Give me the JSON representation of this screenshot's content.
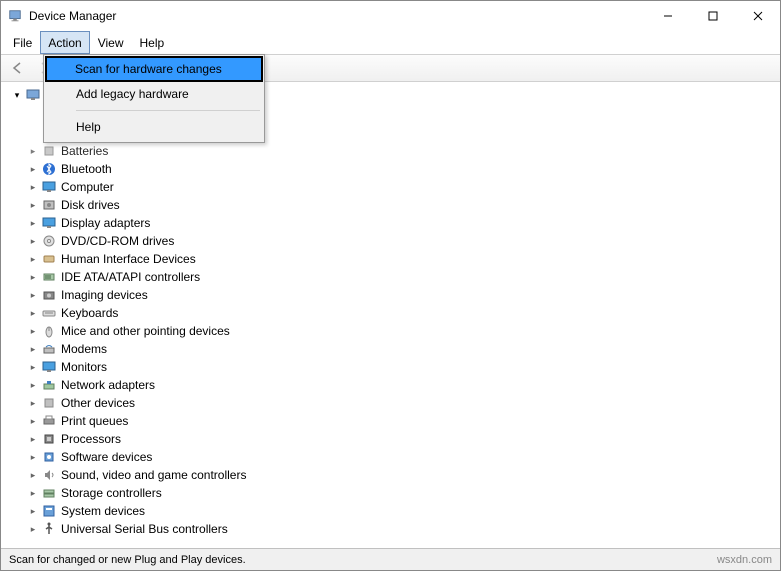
{
  "window": {
    "title": "Device Manager"
  },
  "menubar": {
    "file": "File",
    "action": "Action",
    "view": "View",
    "help": "Help",
    "active": "action"
  },
  "action_menu": {
    "scan": "Scan for hardware changes",
    "add_legacy": "Add legacy hardware",
    "help": "Help"
  },
  "tree": {
    "partial_item": "Batteries",
    "items": [
      "Bluetooth",
      "Computer",
      "Disk drives",
      "Display adapters",
      "DVD/CD-ROM drives",
      "Human Interface Devices",
      "IDE ATA/ATAPI controllers",
      "Imaging devices",
      "Keyboards",
      "Mice and other pointing devices",
      "Modems",
      "Monitors",
      "Network adapters",
      "Other devices",
      "Print queues",
      "Processors",
      "Software devices",
      "Sound, video and game controllers",
      "Storage controllers",
      "System devices",
      "Universal Serial Bus controllers"
    ]
  },
  "statusbar": {
    "text": "Scan for changed or new Plug and Play devices.",
    "source_link": "wsxdn.com"
  },
  "icons": {
    "bluetooth": "bt",
    "computer": "monitor",
    "disk": "disk",
    "display": "monitor",
    "dvd": "disc",
    "hid": "hid",
    "ide": "ide",
    "imaging": "camera",
    "keyboard": "keyboard",
    "mouse": "mouse",
    "modem": "modem",
    "monitor": "monitor",
    "network": "net",
    "other": "generic",
    "print": "printer",
    "processor": "cpu",
    "software": "sw",
    "sound": "sound",
    "storage": "storage",
    "system": "system",
    "usb": "usb"
  }
}
